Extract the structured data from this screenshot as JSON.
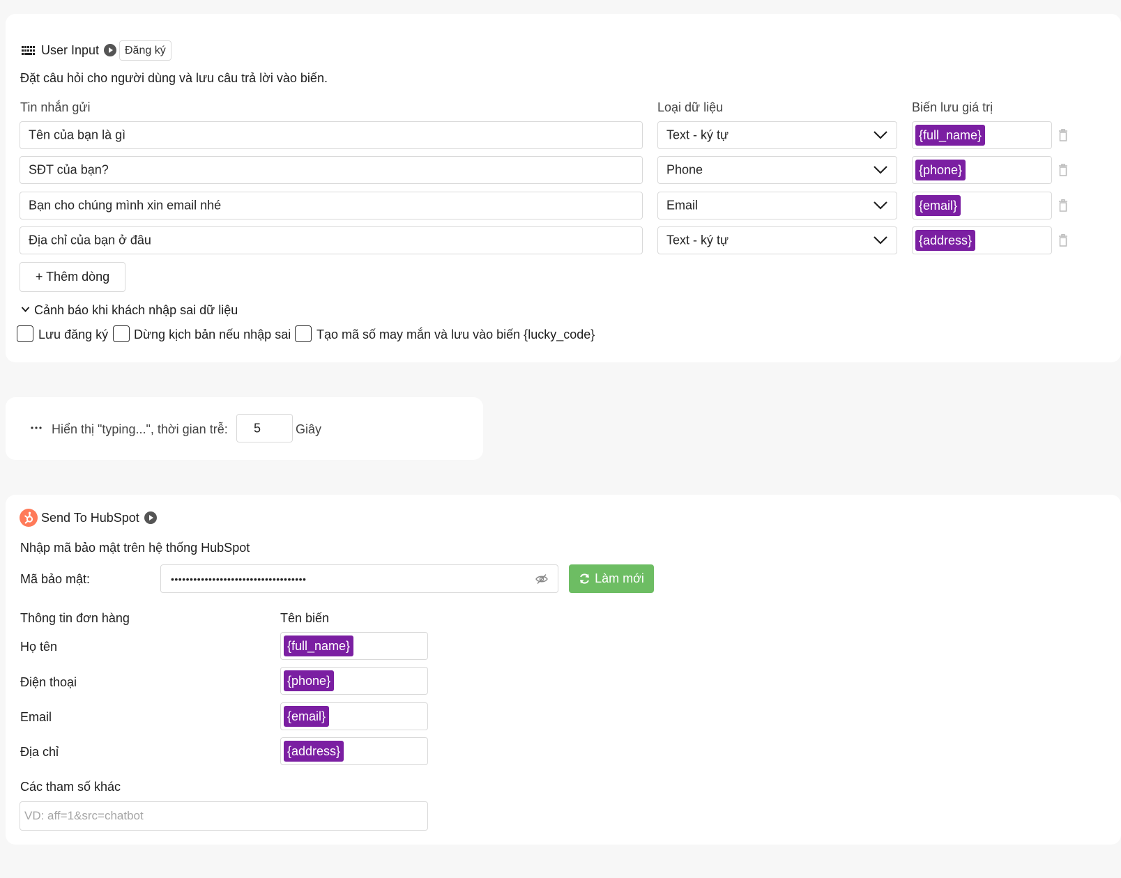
{
  "user_input": {
    "title": "User Input",
    "badge": "Đăng ký",
    "description": "Đặt câu hỏi cho người dùng và lưu câu trả lời vào biến.",
    "col_message": "Tin nhắn gửi",
    "col_type": "Loại dữ liệu",
    "col_var": "Biến lưu giá trị",
    "rows": [
      {
        "message": "Tên của bạn là gì",
        "type": "Text - ký tự",
        "variable": "{full_name}"
      },
      {
        "message": "SĐT của bạn?",
        "type": "Phone",
        "variable": "{phone}"
      },
      {
        "message": "Bạn cho chúng mình xin email nhé",
        "type": "Email",
        "variable": "{email}"
      },
      {
        "message": "Địa chỉ của bạn ở đâu",
        "type": "Text - ký tự",
        "variable": "{address}"
      }
    ],
    "add_row_label": "+ Thêm dòng",
    "warning_label": "Cảnh báo khi khách nhập sai dữ liệu",
    "checkboxes": [
      {
        "label": "Lưu đăng ký",
        "checked": false
      },
      {
        "label": "Dừng kịch bản nếu nhập sai",
        "checked": false
      },
      {
        "label": "Tạo mã số may mắn và lưu vào biến {lucky_code}",
        "checked": false
      }
    ]
  },
  "typing": {
    "label": "Hiển thị \"typing...\", thời gian trễ:",
    "value": "5",
    "unit": "Giây"
  },
  "hubspot": {
    "title": "Send To HubSpot",
    "description": "Nhập mã bảo mật trên hệ thống HubSpot",
    "security_label": "Mã bảo mật:",
    "security_value": "••••••••••••••••••••••••••••••••••••",
    "refresh_label": "Làm mới",
    "col_info": "Thông tin đơn hàng",
    "col_var": "Tên biến",
    "fields": [
      {
        "label": "Họ tên",
        "variable": "{full_name}"
      },
      {
        "label": "Điện thoại",
        "variable": "{phone}"
      },
      {
        "label": "Email",
        "variable": "{email}"
      },
      {
        "label": "Địa chỉ",
        "variable": "{address}"
      }
    ],
    "other_params_label": "Các tham số khác",
    "other_params_placeholder": "VD: aff=1&src=chatbot"
  },
  "colors": {
    "tag": "#7b1fa2",
    "refresh": "#6dbd63",
    "hubspot": "#ff7a59"
  }
}
